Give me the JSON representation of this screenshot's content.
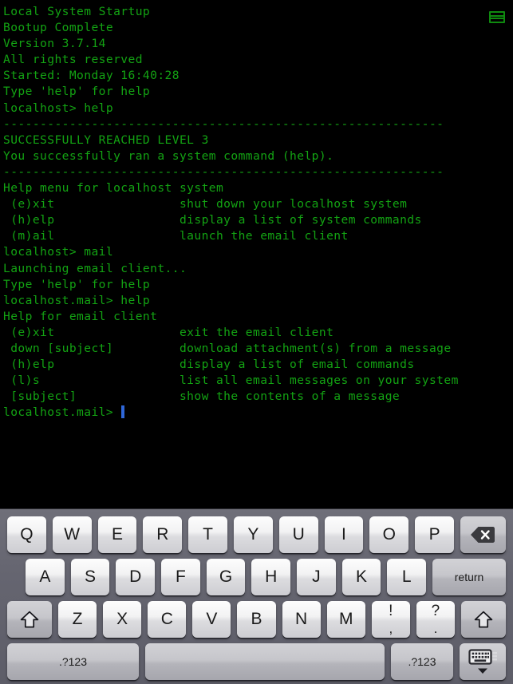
{
  "terminal": {
    "text_color": "#13a313",
    "background_color": "#000000",
    "cursor_color": "#2f67d8",
    "menu_icon": "hamburger-menu-icon",
    "lines": [
      "Local System Startup",
      "Bootup Complete",
      "Version 3.7.14",
      "All rights reserved",
      "Started: Monday 16:40:28",
      "Type 'help' for help",
      "localhost> help",
      "------------------------------------------------------------",
      "SUCCESSFULLY REACHED LEVEL 3",
      "You successfully ran a system command (help).",
      "------------------------------------------------------------",
      "Help menu for localhost system",
      " (e)xit                 shut down your localhost system",
      " (h)elp                 display a list of system commands",
      " (m)ail                 launch the email client",
      "localhost> mail",
      "Launching email client...",
      "Type 'help' for help",
      "localhost.mail> help",
      "Help for email client",
      " (e)xit                 exit the email client",
      " down [subject]         download attachment(s) from a message",
      " (h)elp                 display a list of email commands",
      " (l)s                   list all email messages on your system",
      " [subject]              show the contents of a message"
    ],
    "prompt": "localhost.mail> "
  },
  "keyboard": {
    "background_color": "#65656f",
    "row1": [
      {
        "label": "Q",
        "name": "key-q"
      },
      {
        "label": "W",
        "name": "key-w"
      },
      {
        "label": "E",
        "name": "key-e"
      },
      {
        "label": "R",
        "name": "key-r"
      },
      {
        "label": "T",
        "name": "key-t"
      },
      {
        "label": "Y",
        "name": "key-y"
      },
      {
        "label": "U",
        "name": "key-u"
      },
      {
        "label": "I",
        "name": "key-i"
      },
      {
        "label": "O",
        "name": "key-o"
      },
      {
        "label": "P",
        "name": "key-p"
      }
    ],
    "backspace": {
      "label": "",
      "icon": "backspace-icon",
      "name": "key-backspace"
    },
    "row2": [
      {
        "label": "A",
        "name": "key-a"
      },
      {
        "label": "S",
        "name": "key-s"
      },
      {
        "label": "D",
        "name": "key-d"
      },
      {
        "label": "F",
        "name": "key-f"
      },
      {
        "label": "G",
        "name": "key-g"
      },
      {
        "label": "H",
        "name": "key-h"
      },
      {
        "label": "J",
        "name": "key-j"
      },
      {
        "label": "K",
        "name": "key-k"
      },
      {
        "label": "L",
        "name": "key-l"
      }
    ],
    "return": {
      "label": "return",
      "name": "key-return"
    },
    "row3": [
      {
        "label": "Z",
        "name": "key-z"
      },
      {
        "label": "X",
        "name": "key-x"
      },
      {
        "label": "C",
        "name": "key-c"
      },
      {
        "label": "V",
        "name": "key-v"
      },
      {
        "label": "B",
        "name": "key-b"
      },
      {
        "label": "N",
        "name": "key-n"
      },
      {
        "label": "M",
        "name": "key-m"
      }
    ],
    "shift_left": {
      "icon": "shift-icon",
      "name": "key-shift-left"
    },
    "shift_right": {
      "icon": "shift-icon",
      "name": "key-shift-right"
    },
    "punct_exclaim": {
      "top": "!",
      "bottom": ",",
      "name": "key-exclaim-comma"
    },
    "punct_question": {
      "top": "?",
      "bottom": ".",
      "name": "key-question-period"
    },
    "numeric_left": {
      "label": ".?123",
      "name": "key-numeric-left"
    },
    "space": {
      "label": "",
      "name": "key-space"
    },
    "numeric_right": {
      "label": ".?123",
      "name": "key-numeric-right"
    },
    "hide_keyboard": {
      "icon": "hide-keyboard-icon",
      "name": "key-hide-keyboard"
    }
  }
}
